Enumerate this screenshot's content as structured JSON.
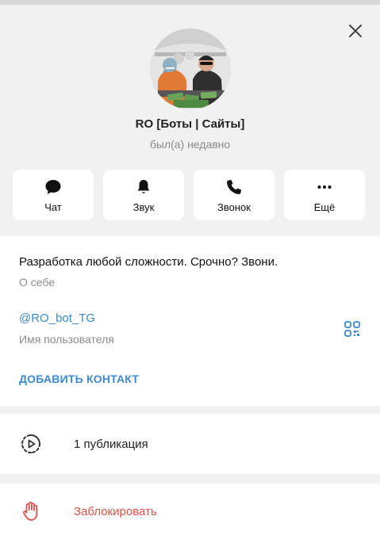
{
  "profile": {
    "name": "RO [Боты | Сайты]",
    "status": "был(а) недавно"
  },
  "actions": [
    {
      "label": "Чат",
      "icon": "chat-bubble-icon"
    },
    {
      "label": "Звук",
      "icon": "bell-icon"
    },
    {
      "label": "Звонок",
      "icon": "phone-icon"
    },
    {
      "label": "Ещё",
      "icon": "more-dots-icon"
    }
  ],
  "info": {
    "bio": "Разработка любой сложности. Срочно? Звони.",
    "bio_caption": "О себе",
    "username": "@RO_bot_TG",
    "username_caption": "Имя пользователя",
    "add_contact": "ДОБАВИТЬ КОНТАКТ"
  },
  "media": {
    "label": "1 публикация",
    "icon": "story-play-icon"
  },
  "block": {
    "label": "Заблокировать",
    "icon": "hand-stop-icon"
  },
  "colors": {
    "accent": "#3b8ad6",
    "danger": "#e0504a",
    "background": "#f1f1f1"
  }
}
